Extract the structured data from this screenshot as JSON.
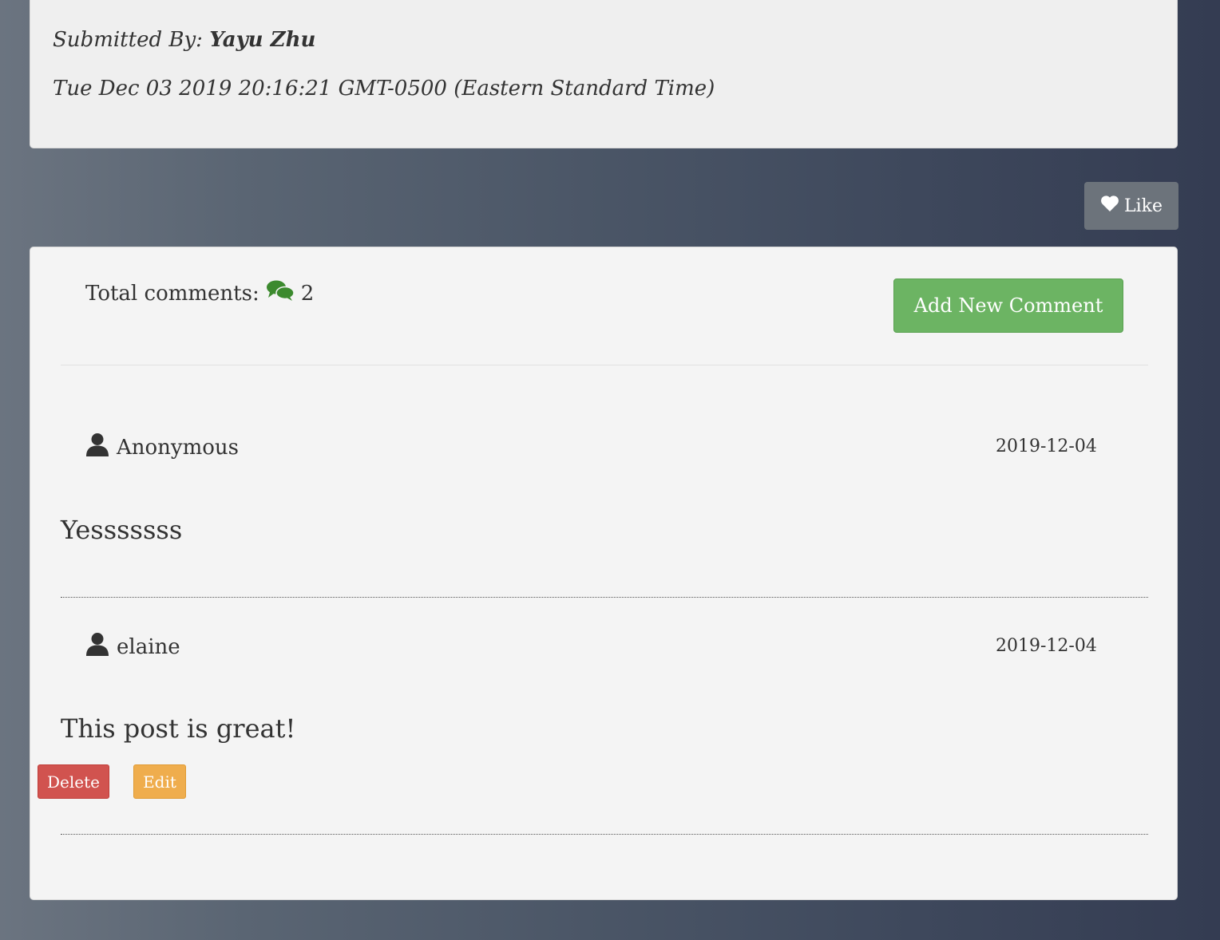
{
  "post": {
    "submitted_label": "Submitted By:",
    "author": "Yayu Zhu",
    "date": "Tue Dec 03 2019 20:16:21 GMT-0500 (Eastern Standard Time)"
  },
  "like": {
    "label": "Like",
    "icon": "heart-icon"
  },
  "comments": {
    "total_label": "Total comments:",
    "total_icon": "comments-icon",
    "total_count": "2",
    "add_label": "Add New Comment",
    "items": [
      {
        "author": "Anonymous",
        "date": "2019-12-04",
        "text": "Yesssssss"
      },
      {
        "author": "elaine",
        "date": "2019-12-04",
        "text": "This post is great!"
      }
    ],
    "delete_label": "Delete",
    "edit_label": "Edit"
  },
  "colors": {
    "add_button": "#6cb463",
    "delete_button": "#d1534f",
    "edit_button": "#efad4d",
    "like_button": "#6c737b",
    "comments_icon": "#3c8a2e"
  }
}
